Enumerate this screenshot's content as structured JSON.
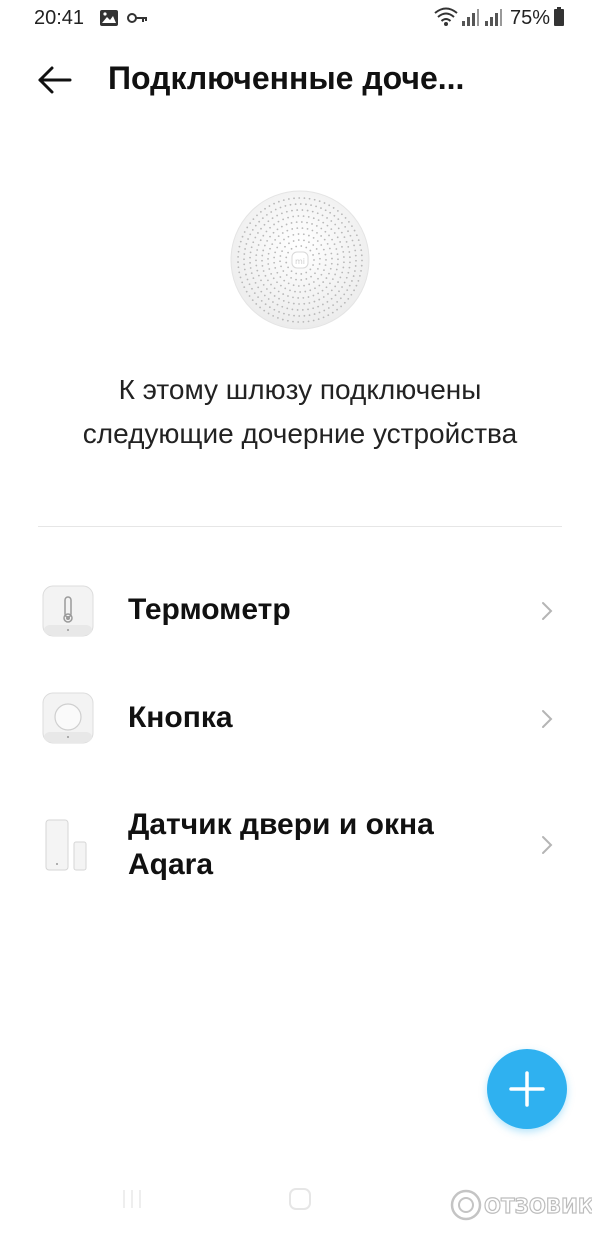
{
  "status_bar": {
    "time": "20:41",
    "battery_percent": "75%",
    "icons": [
      "image-icon",
      "key-icon",
      "wifi-icon",
      "signal-icon",
      "signal-icon",
      "battery-icon"
    ]
  },
  "top_bar": {
    "back_icon": "arrow-left-icon",
    "title": "Подключенные доче..."
  },
  "gateway": {
    "image": "gateway-hub-image",
    "description_line1": "К этому шлюзу подключены",
    "description_line2": "следующие дочерние устройства"
  },
  "devices": [
    {
      "name": "Термометр",
      "icon": "thermometer-sensor-icon"
    },
    {
      "name": "Кнопка",
      "icon": "wireless-button-icon"
    },
    {
      "name_line1": "Датчик двери и окна",
      "name_line2": "Aqara",
      "icon": "door-window-sensor-icon"
    }
  ],
  "fab": {
    "icon": "plus-icon"
  },
  "watermark": {
    "text": "ОТЗОВИК"
  },
  "colors": {
    "accent": "#2fb1f0",
    "text": "#111111",
    "divider": "#e6e6e6",
    "chevron": "#b5b5b5"
  }
}
